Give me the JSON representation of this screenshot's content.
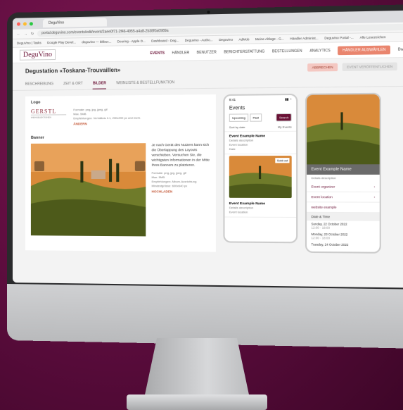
{
  "browser": {
    "tab_title": "DeguVino",
    "url": "portal.deguvino.com/events/edit/event/2aee0f71-2f46-4955-a4a8-2b38f0a0989a",
    "bookmarks": [
      "DeguVino | Tasks",
      "Google Play Devel...",
      "deguvino — Bitbuc...",
      "Deuring - Apple D...",
      "Dashboard - Deg...",
      "Deguvino - Autho...",
      "Deguvino",
      "AdMob",
      "Meine Ablage - G...",
      "Händler Administ...",
      "Deguvino Portal -...",
      "Alle Lesezeichen"
    ]
  },
  "app": {
    "logo": "DeguVino",
    "nav": [
      "EVENTS",
      "HÄNDLER",
      "BENUTZER",
      "BERICHTERSTATTUNG",
      "BESTELLUNGEN",
      "ANALYTICS"
    ],
    "haendler_button": "HÄNDLER AUSWÄHLEN",
    "user": "Bw"
  },
  "page": {
    "title": "Degustation «Toskana-Trouvaillen»",
    "cancel_label": "ABBRECHEN",
    "publish_label": "EVENT VERÖFFENTLICHEN",
    "tabs": [
      "BESCHREIBUNG",
      "ZEIT & ORT",
      "BILDER",
      "WEINLISTE & BESTELLFUNKTION"
    ]
  },
  "logo_section": {
    "label": "Logo",
    "brand": "GERSTL",
    "brand_sub": "WEINSELEKTIONEN",
    "formats": "Formate: png, jpg, jpeg, gif",
    "max": "Max. 5MB",
    "empfehlung": "Empfehlungen: Verhältnis 1:1, 200x200 px und mehr.",
    "change_label": "ÄNDERN"
  },
  "banner_section": {
    "label": "Banner",
    "hint": "Je nach Gerät des Nutzers kann sich die Überlappung des Layouts verschieben. Versuchen Sie, die wichtigsten Informationen in der Mitte Ihres Banners zu platzieren.",
    "formats": "Formate: png, jpg, jpeg, gif",
    "max": "Max. 5MB",
    "empfehlung": "Empfehlungen: Album-Ausrichtung",
    "min_size": "Mindestgrösse: 600x640 px",
    "upload_label": "HOCHLADEN"
  },
  "phone_list": {
    "time": "9:41",
    "title": "Events",
    "upcoming": "Upcoming",
    "past": "Past",
    "search": "Search",
    "sort": "Sort by date",
    "my_events": "My Events",
    "card1_name": "Event Example Name",
    "card_desc": "Details description",
    "card_loc": "Event location",
    "card_date": "Date",
    "sold_out": "Sold out",
    "card2_name": "Event Example Name"
  },
  "phone_detail": {
    "name": "Event Example Name",
    "desc": "Details description",
    "organizer": "Event organizer",
    "location": "Event location",
    "website": "website example",
    "date_head": "Date & Time",
    "dates": [
      {
        "day": "Sunday, 22 October 2022",
        "time": "12:00 - 18:00"
      },
      {
        "day": "Monday, 23 October 2022",
        "time": "12:00 - 18:00"
      },
      {
        "day": "Tuesday, 24 October 2022",
        "time": ""
      }
    ]
  },
  "colors": {
    "brand": "#6a1236",
    "accent": "#e9856e",
    "background": "#5a0c3c"
  }
}
